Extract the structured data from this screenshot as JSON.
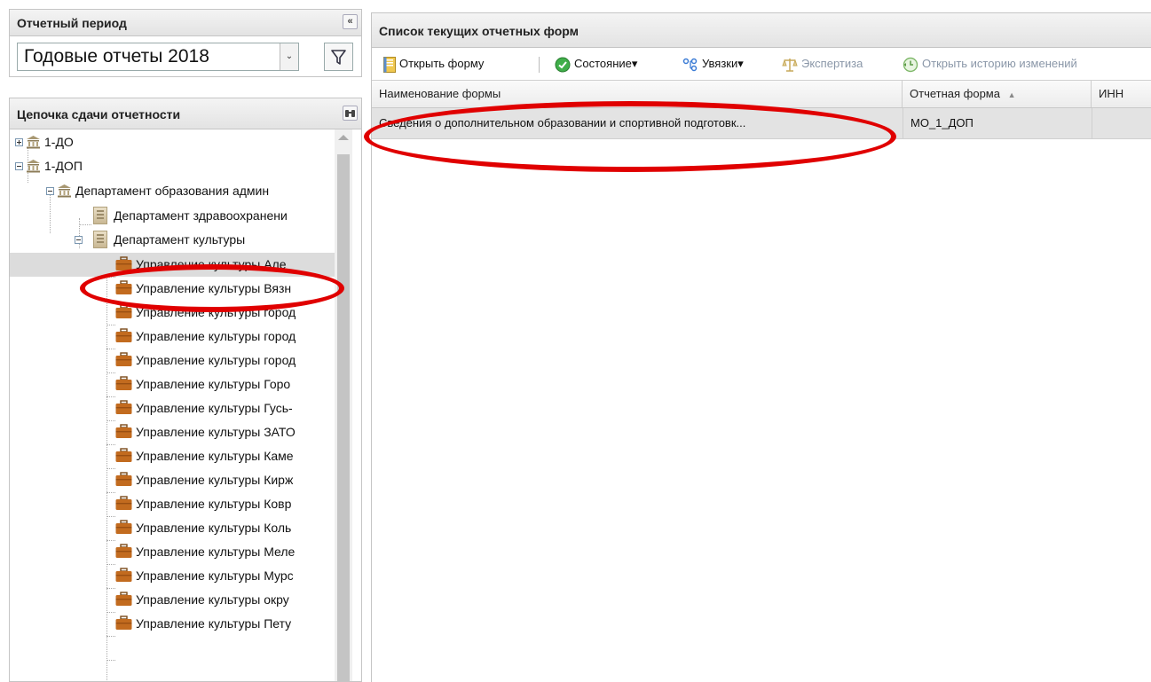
{
  "left": {
    "period": {
      "title": "Отчетный период",
      "collapse_icon": "double-chevron-left-icon",
      "selected": "Годовые отчеты 2018",
      "arrow": "⌄",
      "filter_icon": "funnel-icon"
    },
    "chain": {
      "title": "Цепочка сдачи отчетности",
      "search_icon": "binoculars-icon",
      "tree": [
        {
          "label": "1-ДО"
        },
        {
          "label": "1-ДОП"
        },
        {
          "label": "Департамент образования админ"
        },
        {
          "label": "Департамент здравоохранени"
        },
        {
          "label": "Департамент культуры"
        },
        {
          "label": "Управление культуры Але"
        },
        {
          "label": "Управление культуры Вязн"
        },
        {
          "label": "Управление культуры город"
        },
        {
          "label": "Управление культуры город"
        },
        {
          "label": "Управление культуры город"
        },
        {
          "label": "Управление культуры Горо"
        },
        {
          "label": "Управление культуры Гусь-"
        },
        {
          "label": "Управление культуры ЗАТО"
        },
        {
          "label": "Управление культуры Каме"
        },
        {
          "label": "Управление культуры Кирж"
        },
        {
          "label": "Управление культуры Ковр"
        },
        {
          "label": "Управление культуры Коль"
        },
        {
          "label": "Управление культуры Меле"
        },
        {
          "label": "Управление культуры Мурс"
        },
        {
          "label": "Управление культуры окру"
        },
        {
          "label": "Управление культуры Пету"
        }
      ]
    }
  },
  "right": {
    "title": "Список текущих отчетных форм",
    "toolbar": {
      "open_form": "Открыть форму",
      "state": "Состояние",
      "links": "Увязки",
      "expertise": "Экспертиза",
      "history": "Открыть историю изменений",
      "dropdown_arrow": "▾"
    },
    "grid": {
      "columns": [
        "Наименование формы",
        "Отчетная форма",
        "ИНН"
      ],
      "sort_indicator": "▲",
      "rows": [
        {
          "name": "Сведения о дополнительном образовании и спортивной подготовк...",
          "form": "МО_1_ДОП",
          "inn": ""
        }
      ]
    }
  },
  "colors": {
    "annotation": "#e00000",
    "selected_row": "#dcdcdc"
  }
}
